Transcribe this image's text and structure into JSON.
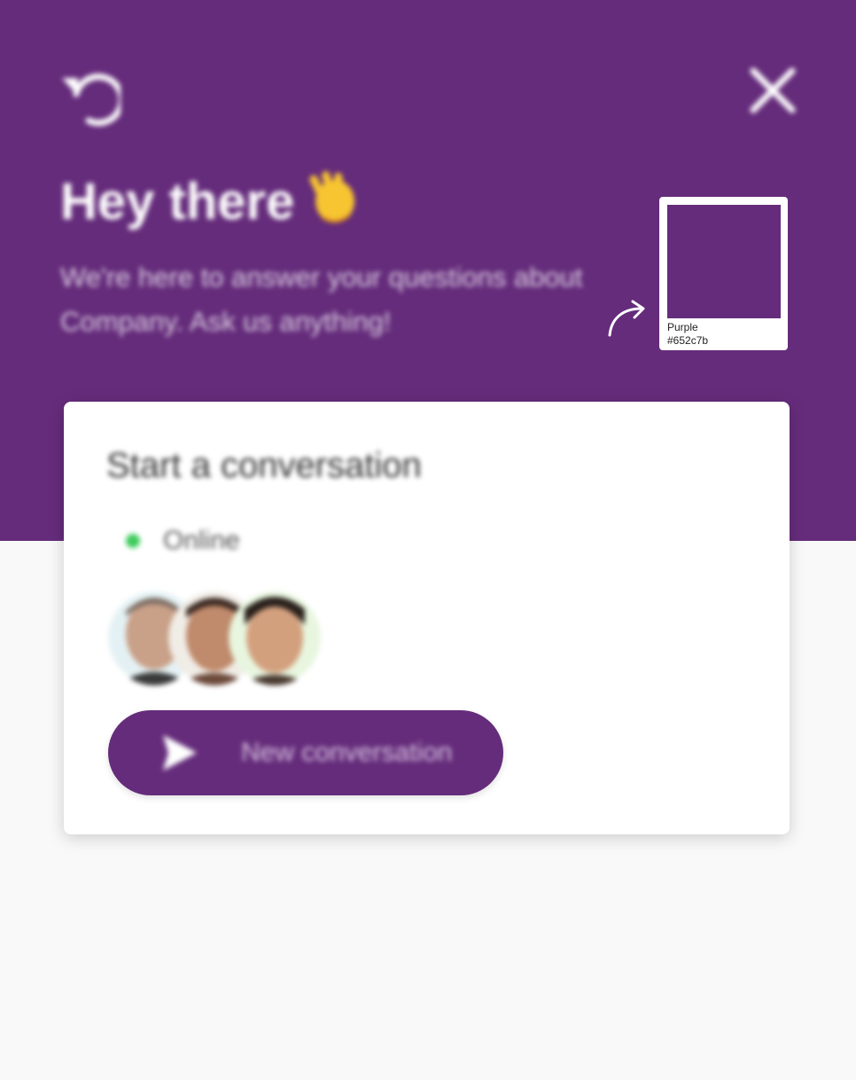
{
  "theme": {
    "accent": "#652c7b",
    "online_color": "#3ecb5c",
    "background": "#f9f9f9"
  },
  "header": {
    "greeting": "Hey there",
    "greeting_emoji": "waving-hand-icon",
    "subtitle": "We're here to answer your questions about Company. Ask us anything!",
    "back_icon": "undo-icon",
    "close_icon": "close-icon"
  },
  "card": {
    "title": "Start a conversation",
    "status": "Online",
    "avatars": [
      "team-member-1",
      "team-member-2",
      "team-member-3"
    ],
    "button_label": "New conversation",
    "button_icon": "send-icon"
  },
  "swatch": {
    "name": "Purple",
    "hex": "#652c7b"
  }
}
